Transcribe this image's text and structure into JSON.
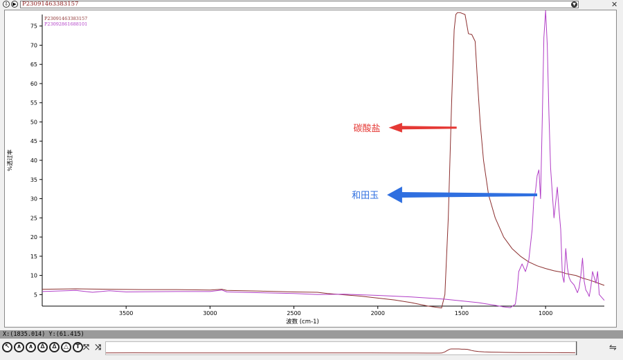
{
  "toolbar_top": {
    "down_btn": "⇩",
    "play_btn": "▶",
    "selected_sample": "P23091463383157"
  },
  "chart_data": {
    "type": "line",
    "xlabel": "波数 (cm-1)",
    "ylabel": "%透过率",
    "xlim": [
      4000,
      650
    ],
    "ylim": [
      2,
      78
    ],
    "x_ticks": [
      3500,
      3000,
      2500,
      2000,
      1500,
      1000
    ],
    "y_ticks": [
      5,
      10,
      15,
      20,
      25,
      30,
      35,
      40,
      45,
      50,
      55,
      60,
      65,
      70,
      75
    ],
    "series": [
      {
        "name": "P23091463383157",
        "color": "#8b2e2e",
        "x": [
          4000,
          3800,
          3600,
          3400,
          3200,
          3000,
          2930,
          2900,
          2700,
          2500,
          2360,
          2300,
          2100,
          1900,
          1800,
          1700,
          1620,
          1600,
          1580,
          1560,
          1545,
          1535,
          1525,
          1510,
          1480,
          1460,
          1440,
          1420,
          1405,
          1390,
          1370,
          1340,
          1300,
          1250,
          1200,
          1150,
          1100,
          1050,
          1000,
          950,
          900,
          880,
          860,
          820,
          780,
          740,
          700,
          650
        ],
        "values": [
          6.4,
          6.5,
          6.4,
          6.3,
          6.3,
          6.2,
          6.4,
          6.1,
          5.9,
          5.7,
          5.6,
          5.3,
          4.6,
          3.6,
          2.9,
          2.0,
          1.5,
          5,
          25,
          55,
          74,
          78,
          78.5,
          78.5,
          78,
          73,
          72.8,
          71,
          60,
          50,
          40,
          31,
          25,
          20,
          17,
          15,
          13.5,
          12.5,
          11.8,
          11.2,
          10.8,
          10.5,
          10.3,
          10.0,
          9.3,
          8.8,
          8.2,
          7.4
        ]
      },
      {
        "name": "P23092861688101",
        "color": "#b03cc6",
        "x": [
          4000,
          3800,
          3700,
          3600,
          3500,
          3200,
          3000,
          2930,
          2900,
          2500,
          2360,
          2200,
          2000,
          1800,
          1600,
          1400,
          1300,
          1250,
          1210,
          1180,
          1170,
          1160,
          1140,
          1120,
          1100,
          1080,
          1070,
          1060,
          1050,
          1040,
          1030,
          1020,
          1010,
          1000,
          990,
          980,
          970,
          950,
          930,
          920,
          910,
          900,
          890,
          880,
          870,
          860,
          850,
          830,
          820,
          810,
          800,
          790,
          780,
          770,
          760,
          750,
          740,
          730,
          720,
          700,
          690,
          680,
          660,
          650
        ],
        "values": [
          5.8,
          6.1,
          5.6,
          6.0,
          5.7,
          5.8,
          5.8,
          6.2,
          5.7,
          5.3,
          5.0,
          5.1,
          4.8,
          4.4,
          3.8,
          2.9,
          2.2,
          1.8,
          1.6,
          2.5,
          6,
          11,
          13,
          11,
          14,
          22,
          30,
          32,
          36,
          37.5,
          30,
          50,
          72,
          79,
          70,
          52,
          38,
          25,
          33,
          27,
          22,
          10,
          8.2,
          17,
          12,
          9.5,
          8.5,
          7.5,
          6.5,
          5.5,
          6.8,
          10,
          14.5,
          8.5,
          6.2,
          5.5,
          4.5,
          7,
          11,
          8,
          11,
          5,
          4,
          3.5
        ]
      }
    ],
    "annotations": [
      {
        "text": "碳酸盐",
        "color": "#e53935"
      },
      {
        "text": "和田玉",
        "color": "#2f6fe0"
      }
    ]
  },
  "status": {
    "cursor_readout": "X:(1835.014) Y:(61.415)"
  },
  "tools": [
    "pointer-tool",
    "peak-tool",
    "zoom-tool",
    "pan-tool",
    "baseline-tool",
    "text-tool",
    "expand-tool",
    "compress-tool"
  ]
}
